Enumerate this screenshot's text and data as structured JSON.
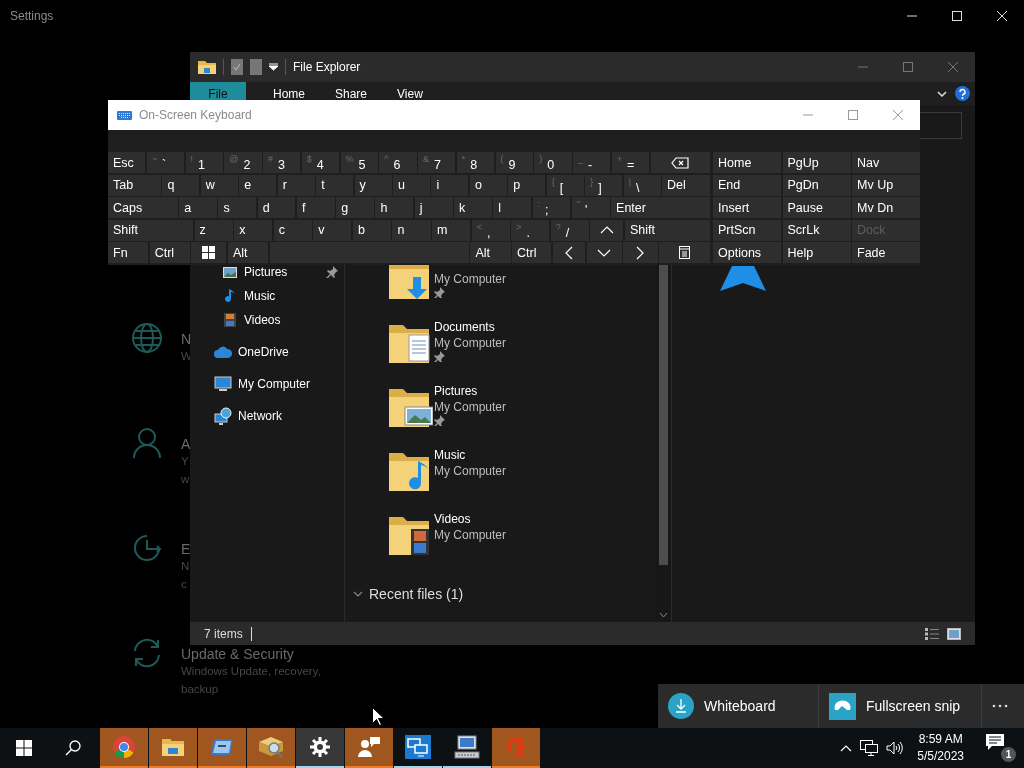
{
  "settings": {
    "title": "Settings",
    "items": [
      {
        "kind": "network",
        "title": "N",
        "lines": [
          "W"
        ]
      },
      {
        "kind": "accounts",
        "title": "A",
        "lines": [
          "Y",
          "w"
        ]
      },
      {
        "kind": "time",
        "title": "E",
        "lines": [
          "N",
          "c"
        ]
      },
      {
        "kind": "update",
        "title": "Update & Security",
        "lines": [
          "Windows Update, recovery,",
          "backup"
        ]
      }
    ]
  },
  "file_explorer": {
    "title": "File Explorer",
    "ribbon_tabs": [
      {
        "label": "File",
        "kind": "file-menu"
      },
      {
        "label": "Home",
        "kind": "tab"
      },
      {
        "label": "Share",
        "kind": "tab"
      },
      {
        "label": "View",
        "kind": "tab"
      }
    ],
    "nav_pane": {
      "quick_access": [
        {
          "label": "Pictures",
          "kind": "pictures",
          "pinned": true
        },
        {
          "label": "Music",
          "kind": "music",
          "pinned": false
        },
        {
          "label": "Videos",
          "kind": "videos",
          "pinned": false
        }
      ],
      "locations": [
        {
          "label": "OneDrive",
          "kind": "cloud"
        },
        {
          "label": "My Computer",
          "kind": "computer"
        },
        {
          "label": "Network",
          "kind": "network"
        }
      ]
    },
    "folders": [
      {
        "location": "My Computer",
        "kind": "downloads",
        "pinned": true
      },
      {
        "name": "Documents",
        "location": "My Computer",
        "kind": "documents",
        "pinned": true
      },
      {
        "name": "Pictures",
        "location": "My Computer",
        "kind": "pictures",
        "pinned": true
      },
      {
        "name": "Music",
        "location": "My Computer",
        "kind": "music",
        "pinned": false
      },
      {
        "name": "Videos",
        "location": "My Computer",
        "kind": "videos",
        "pinned": false
      }
    ],
    "groups": [
      {
        "label": "Recent files (1)",
        "expanded": true
      }
    ],
    "status_bar": {
      "item_count": "7 items"
    }
  },
  "on_screen_keyboard": {
    "title": "On-Screen Keyboard",
    "rows": [
      [
        {
          "label": "Esc"
        },
        {
          "label": "`",
          "shift": "~"
        },
        {
          "label": "1",
          "shift": "!"
        },
        {
          "label": "2",
          "shift": "@"
        },
        {
          "label": "3",
          "shift": "#"
        },
        {
          "label": "4",
          "shift": "$"
        },
        {
          "label": "5",
          "shift": "%"
        },
        {
          "label": "6",
          "shift": "^"
        },
        {
          "label": "7",
          "shift": "&"
        },
        {
          "label": "8",
          "shift": "*"
        },
        {
          "label": "9",
          "shift": "("
        },
        {
          "label": "0",
          "shift": ")"
        },
        {
          "label": "-",
          "shift": "_"
        },
        {
          "label": "=",
          "shift": "+"
        },
        {
          "kind": "backspace"
        }
      ],
      [
        {
          "label": "Tab"
        },
        {
          "label": "q"
        },
        {
          "label": "w"
        },
        {
          "label": "e"
        },
        {
          "label": "r"
        },
        {
          "label": "t"
        },
        {
          "label": "y"
        },
        {
          "label": "u"
        },
        {
          "label": "i"
        },
        {
          "label": "o"
        },
        {
          "label": "p"
        },
        {
          "label": "[",
          "shift": "{"
        },
        {
          "label": "]",
          "shift": "}"
        },
        {
          "label": "\\",
          "shift": "|"
        },
        {
          "label": "Del"
        }
      ],
      [
        {
          "label": "Caps"
        },
        {
          "label": "a"
        },
        {
          "label": "s"
        },
        {
          "label": "d"
        },
        {
          "label": "f"
        },
        {
          "label": "g"
        },
        {
          "label": "h"
        },
        {
          "label": "j"
        },
        {
          "label": "k"
        },
        {
          "label": "l"
        },
        {
          "label": ";",
          "shift": ":"
        },
        {
          "label": "'",
          "shift": "\""
        },
        {
          "label": "Enter"
        }
      ],
      [
        {
          "label": "Shift"
        },
        {
          "label": "z"
        },
        {
          "label": "x"
        },
        {
          "label": "c"
        },
        {
          "label": "v"
        },
        {
          "label": "b"
        },
        {
          "label": "n"
        },
        {
          "label": "m"
        },
        {
          "label": ",",
          "shift": "<"
        },
        {
          "label": ".",
          "shift": ">"
        },
        {
          "label": "/",
          "shift": "?"
        },
        {
          "kind": "arrow-up"
        },
        {
          "label": "Shift"
        }
      ],
      [
        {
          "label": "Fn"
        },
        {
          "label": "Ctrl"
        },
        {
          "kind": "windows"
        },
        {
          "label": "Alt"
        },
        {
          "kind": "space"
        },
        {
          "label": "Alt"
        },
        {
          "label": "Ctrl"
        },
        {
          "kind": "arrow-left"
        },
        {
          "kind": "arrow-down"
        },
        {
          "kind": "arrow-right"
        },
        {
          "kind": "menu"
        }
      ]
    ],
    "nav_keys": [
      [
        {
          "label": "Home",
          "disabled": false
        },
        {
          "label": "PgUp",
          "disabled": false
        },
        {
          "label": "Nav",
          "disabled": false
        }
      ],
      [
        {
          "label": "End",
          "disabled": false
        },
        {
          "label": "PgDn",
          "disabled": false
        },
        {
          "label": "Mv Up",
          "disabled": false
        }
      ],
      [
        {
          "label": "Insert",
          "disabled": false
        },
        {
          "label": "Pause",
          "disabled": false
        },
        {
          "label": "Mv Dn",
          "disabled": false
        }
      ],
      [
        {
          "label": "PrtScn",
          "disabled": false
        },
        {
          "label": "ScrLk",
          "disabled": false
        },
        {
          "label": "Dock",
          "disabled": true
        }
      ],
      [
        {
          "label": "Options",
          "disabled": false
        },
        {
          "label": "Help",
          "disabled": false
        },
        {
          "label": "Fade",
          "disabled": false
        }
      ]
    ]
  },
  "quick_actions": [
    {
      "label": "Whiteboard",
      "kind": "download"
    },
    {
      "label": "Fullscreen snip",
      "kind": "snip"
    }
  ],
  "taskbar": {
    "apps": [
      {
        "kind": "browser",
        "flashing": true,
        "active": false
      },
      {
        "kind": "files",
        "flashing": true,
        "active": false
      },
      {
        "kind": "app-window",
        "flashing": true,
        "active": false
      },
      {
        "kind": "finder",
        "flashing": true,
        "active": false
      },
      {
        "kind": "settings",
        "flashing": false,
        "active": true
      },
      {
        "kind": "people",
        "flashing": true,
        "active": false
      },
      {
        "kind": "remote",
        "flashing": false,
        "active": false
      },
      {
        "kind": "computer",
        "flashing": false,
        "active": false
      },
      {
        "kind": "office",
        "flashing": true,
        "active": false
      }
    ],
    "clock": {
      "time": "8:59 AM",
      "date": "5/5/2023"
    },
    "notification_count": "1"
  }
}
